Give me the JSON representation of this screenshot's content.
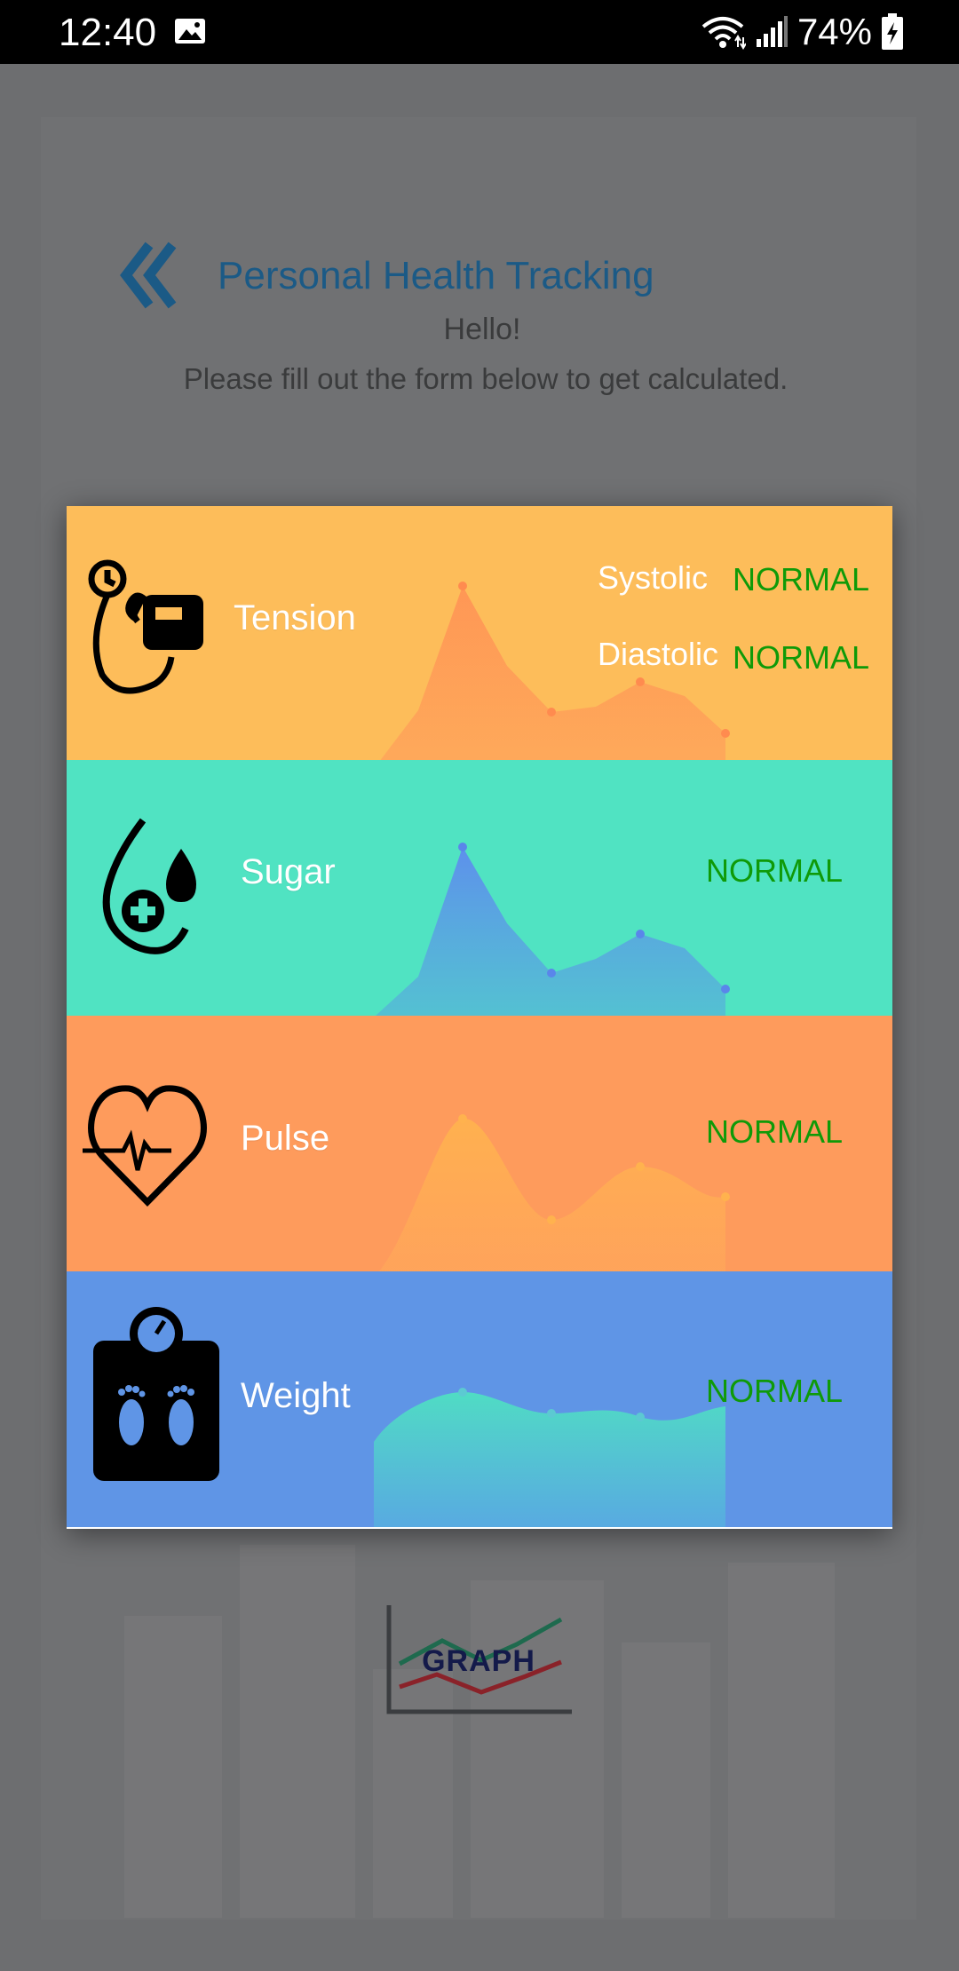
{
  "status_bar": {
    "time": "12:40",
    "battery": "74%"
  },
  "page": {
    "title": "Personal Health Tracking",
    "greeting": "Hello!",
    "instruction": "Please fill out the form below to get calculated."
  },
  "graph_button": {
    "label": "GRAPH"
  },
  "panels": {
    "tension": {
      "label": "Tension",
      "systolic_label": "Systolic",
      "systolic_status": "NORMAL",
      "diastolic_label": "Diastolic",
      "diastolic_status": "NORMAL",
      "color": "#fdbd5a"
    },
    "sugar": {
      "label": "Sugar",
      "status": "NORMAL",
      "color": "#50e3c2"
    },
    "pulse": {
      "label": "Pulse",
      "status": "NORMAL",
      "color": "#fe9b5c"
    },
    "weight": {
      "label": "Weight",
      "status": "NORMAL",
      "color": "#5f95e6"
    }
  },
  "colors": {
    "status_normal": "#0f9a08",
    "title": "#1b5a86"
  }
}
